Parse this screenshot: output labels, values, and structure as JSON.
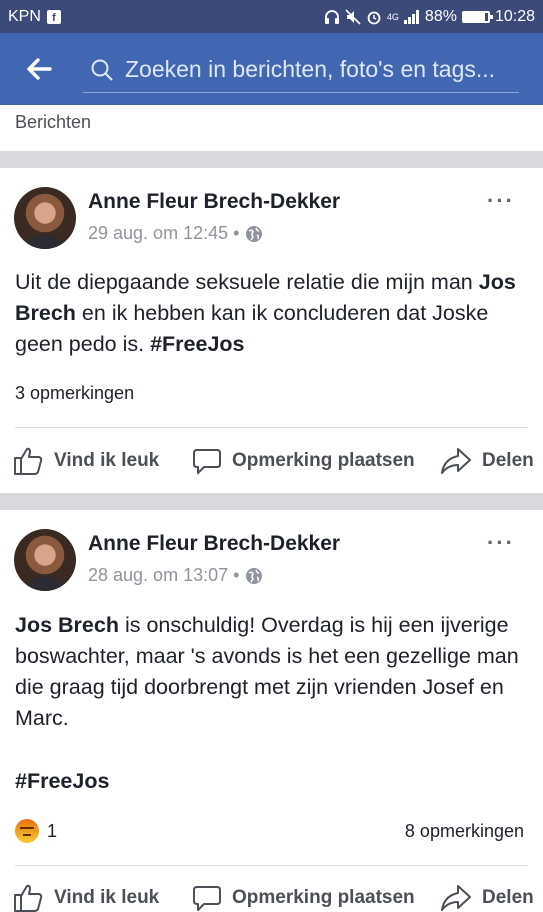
{
  "status_bar": {
    "carrier": "KPN",
    "network": "4G",
    "battery": "88%",
    "battery_level": 0.88,
    "time": "10:28"
  },
  "nav": {
    "search_placeholder": "Zoeken in berichten, foto's en tags..."
  },
  "section": {
    "title": "Berichten"
  },
  "posts": [
    {
      "author": "Anne Fleur Brech-Dekker",
      "date": "29 aug. om 12:45 •",
      "text_parts": [
        "Uit de diepgaande seksuele relatie die mijn man ",
        "Jos Brech",
        " en ik hebben kan ik concluderen dat Joske geen pedo is. ",
        "#FreeJos"
      ],
      "comments": "3 opmerkingen",
      "actions": {
        "like": "Vind ik leuk",
        "comment": "Opmerking plaatsen",
        "share": "Delen"
      }
    },
    {
      "author": "Anne Fleur Brech-Dekker",
      "date": "28 aug. om 13:07 •",
      "text_parts": [
        "Jos Brech",
        " is onschuldig! Overdag is hij een ijverige boswachter, maar 's avonds is het een gezellige man die graag tijd doorbrengt met zijn vrienden Josef en Marc.",
        "#FreeJos"
      ],
      "reaction_count": "1",
      "comments": "8 opmerkingen",
      "actions": {
        "like": "Vind ik leuk",
        "comment": "Opmerking plaatsen",
        "share": "Delen"
      }
    }
  ],
  "colors": {
    "status_bar": "#3b4a78",
    "nav_bar": "#4267b2",
    "divider": "#d7d9dd",
    "meta_text": "#90949c"
  },
  "icons": {
    "back": "arrow-left-icon",
    "search": "search-icon",
    "globe": "globe-icon",
    "more": "more-dots-icon",
    "like": "thumbs-up-icon",
    "comment": "speech-bubble-icon",
    "share": "share-arrow-icon",
    "reaction": "angry-reaction-icon"
  }
}
